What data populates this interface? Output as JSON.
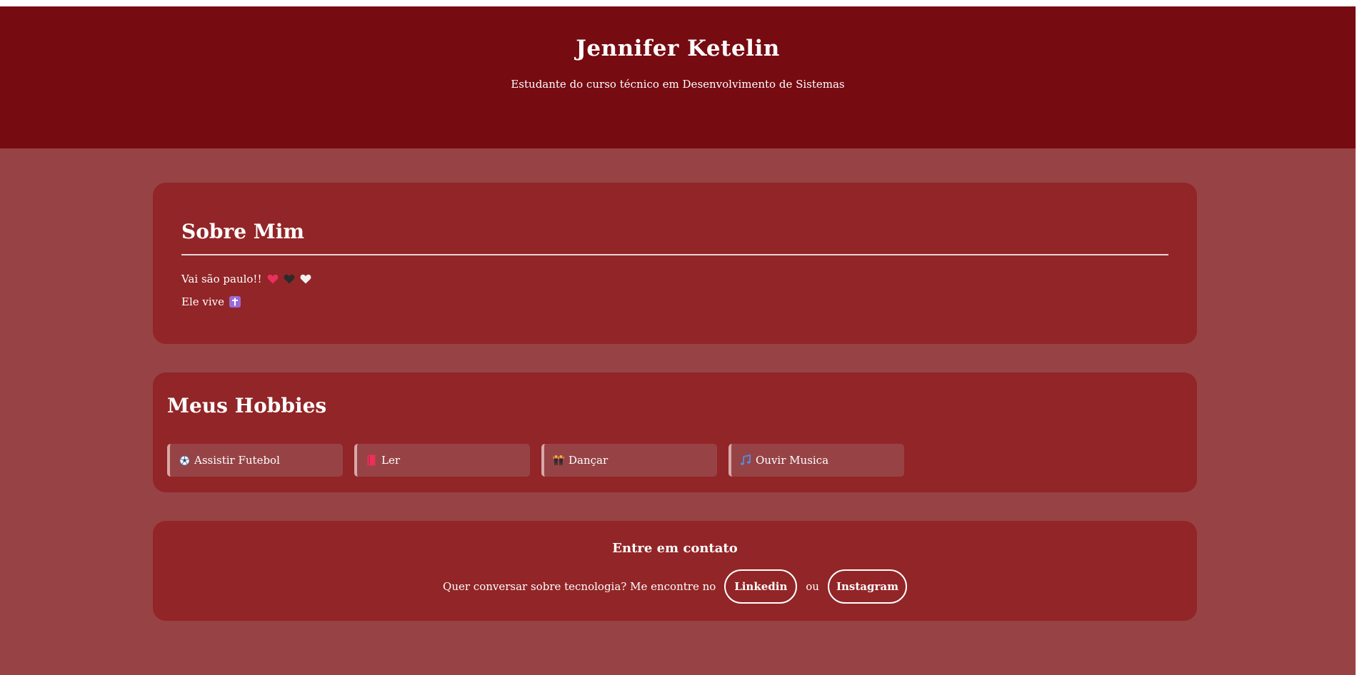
{
  "header": {
    "title": "Jennifer Ketelin",
    "subtitle": "Estudante do curso técnico em Desenvolvimento de Sistemas"
  },
  "about": {
    "title": "Sobre Mim",
    "line1": "Vai são paulo!!",
    "line1_icons": [
      "red-heart-icon",
      "black-heart-icon",
      "white-heart-icon"
    ],
    "line2": "Ele vive",
    "line2_icon": "latin-cross-icon"
  },
  "hobbies": {
    "title": "Meus Hobbies",
    "items": [
      {
        "label": "Assistir Futebol",
        "icon": "soccer-ball-icon"
      },
      {
        "label": "Ler",
        "icon": "book-icon"
      },
      {
        "label": "Dançar",
        "icon": "dancers-icon"
      },
      {
        "label": "Ouvir Musica",
        "icon": "music-note-icon"
      }
    ]
  },
  "contact": {
    "title": "Entre em contato",
    "text": "Quer conversar sobre tecnologia? Me encontre no",
    "linkedin_label": "Linkedin",
    "separator": "ou",
    "instagram_label": "Instagram"
  },
  "colors": {
    "header_bg": "#760b12",
    "page_bg": "#974346",
    "card_bg": "#922527",
    "hobby_bg": "#974346",
    "hobby_border": "#d9a8aa"
  }
}
